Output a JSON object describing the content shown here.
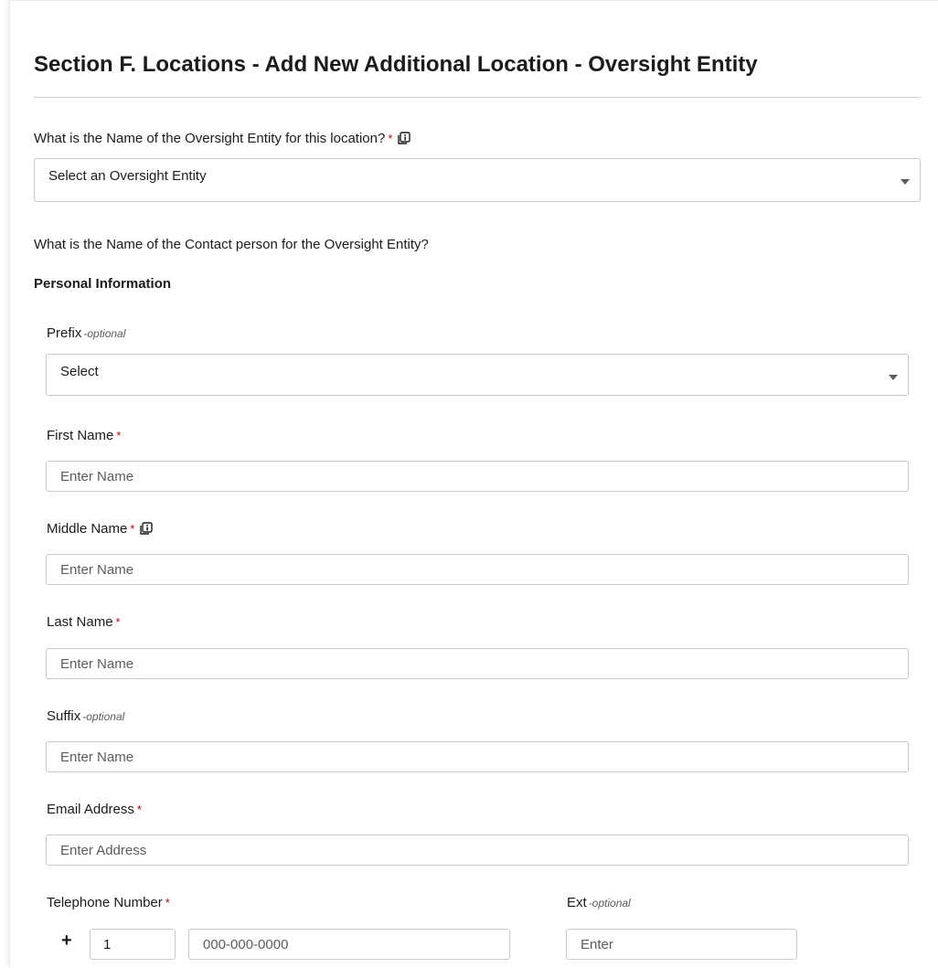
{
  "form": {
    "title": "Section F. Locations - Add New Additional Location - Oversight Entity",
    "oversight_question": "What is the Name of the Oversight Entity for this location?",
    "required_marker": "*",
    "oversight_select": {
      "value": "Select an Oversight Entity"
    },
    "contact_question": "What is the Name of the Contact person for the Oversight Entity?",
    "personal_info_heading": "Personal Information",
    "optional_marker": "-optional"
  },
  "fields": {
    "prefix": {
      "label": "Prefix",
      "value": "Select"
    },
    "first_name": {
      "label": "First Name",
      "placeholder": "Enter Name"
    },
    "middle_name": {
      "label": "Middle Name",
      "placeholder": "Enter Name"
    },
    "last_name": {
      "label": "Last Name",
      "placeholder": "Enter Name"
    },
    "suffix": {
      "label": "Suffix",
      "placeholder": "Enter Name"
    },
    "email": {
      "label": "Email Address",
      "placeholder": "Enter Address"
    },
    "telephone": {
      "label": "Telephone Number",
      "plus": "+",
      "country_code": "1",
      "placeholder": "000-000-0000"
    },
    "ext": {
      "label": "Ext",
      "placeholder": "Enter"
    }
  },
  "icons": {
    "info": "info-icon"
  },
  "colors": {
    "required": "#b50909",
    "border": "#c8c8c8",
    "text": "#1b1b1b"
  }
}
